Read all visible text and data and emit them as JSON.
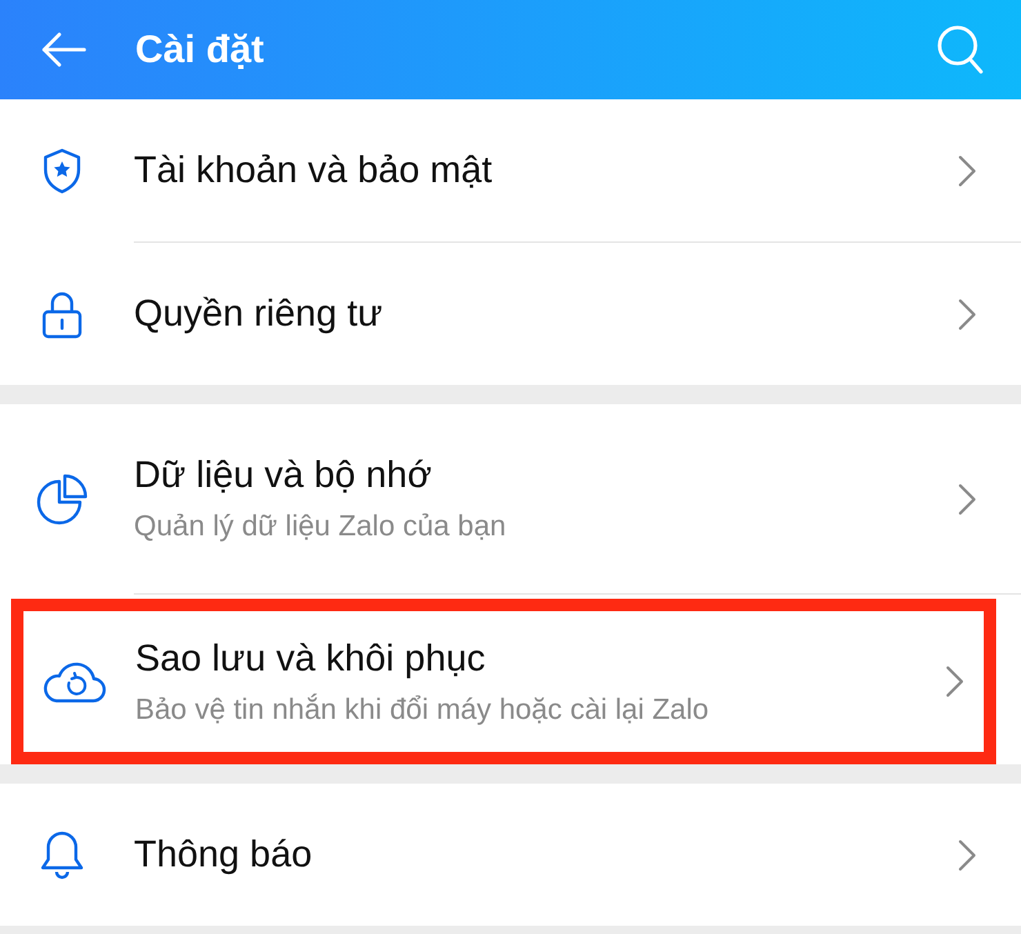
{
  "header": {
    "title": "Cài đặt"
  },
  "groups": [
    {
      "items": [
        {
          "kind": "shield",
          "title": "Tài khoản và bảo mật",
          "highlighted": false
        },
        {
          "kind": "lock",
          "title": "Quyền riêng tư",
          "highlighted": false
        }
      ]
    },
    {
      "items": [
        {
          "kind": "pie",
          "title": "Dữ liệu và bộ nhớ",
          "subtitle": "Quản lý dữ liệu Zalo của bạn",
          "highlighted": false
        },
        {
          "kind": "cloud",
          "title": "Sao lưu và khôi phục",
          "subtitle": "Bảo vệ tin nhắn khi đổi máy hoặc cài lại Zalo",
          "highlighted": true
        }
      ]
    },
    {
      "items": [
        {
          "kind": "bell",
          "title": "Thông báo",
          "highlighted": false
        }
      ]
    }
  ]
}
